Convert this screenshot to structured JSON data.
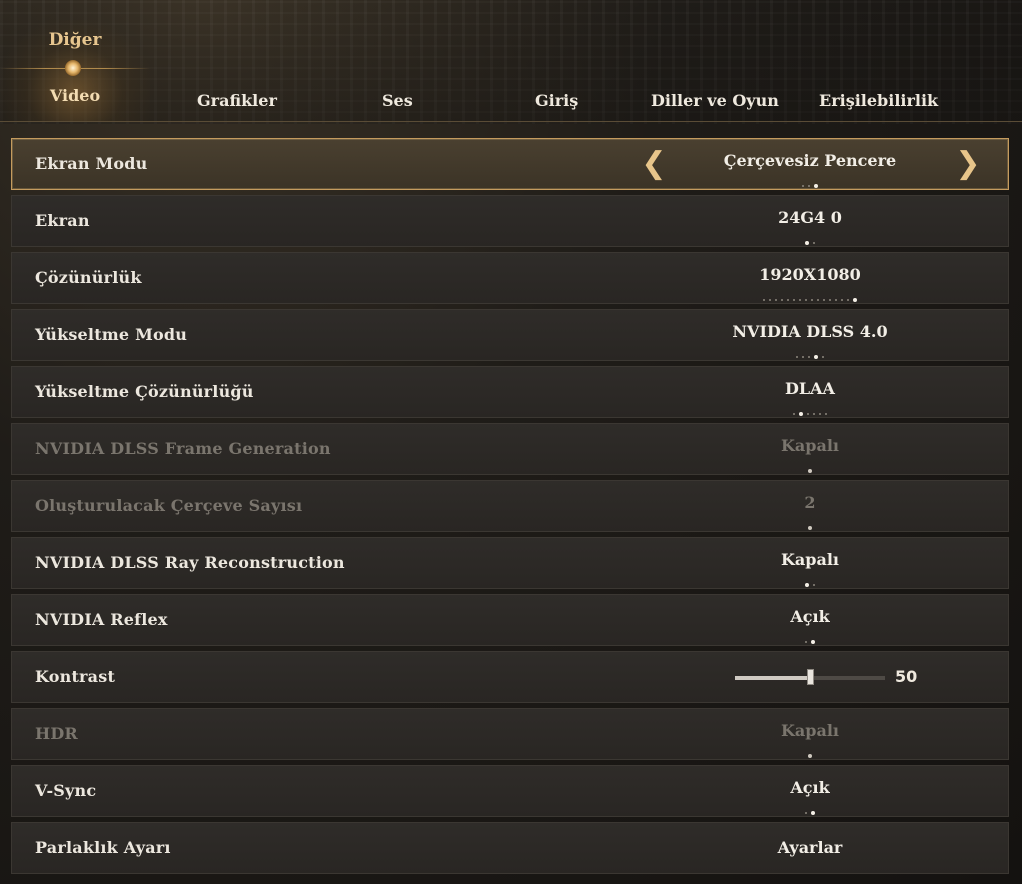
{
  "nav": {
    "active_group": "Diğer",
    "active_tab": "Video",
    "tabs": [
      {
        "label": "Grafikler"
      },
      {
        "label": "Ses"
      },
      {
        "label": "Giriş"
      },
      {
        "label": "Diller ve Oyun"
      },
      {
        "label": "Erişilebilirlik"
      }
    ]
  },
  "settings": [
    {
      "label": "Ekran Modu",
      "value": "Çerçevesiz Pencere",
      "selected": true,
      "disabled": false,
      "option_count": 3,
      "option_index": 2
    },
    {
      "label": "Ekran",
      "value": "24G4 0",
      "disabled": false,
      "option_count": 2,
      "option_index": 0
    },
    {
      "label": "Çözünürlük",
      "value": "1920X1080",
      "disabled": false,
      "option_count": 16,
      "option_index": 15
    },
    {
      "label": "Yükseltme Modu",
      "value": "NVIDIA DLSS 4.0",
      "disabled": false,
      "option_count": 5,
      "option_index": 3
    },
    {
      "label": "Yükseltme Çözünürlüğü",
      "value": "DLAA",
      "disabled": false,
      "option_count": 6,
      "option_index": 1
    },
    {
      "label": "NVIDIA DLSS Frame Generation",
      "value": "Kapalı",
      "disabled": true,
      "option_count": 1,
      "option_index": 0
    },
    {
      "label": "Oluşturulacak Çerçeve Sayısı",
      "value": "2",
      "disabled": true,
      "option_count": 1,
      "option_index": 0
    },
    {
      "label": "NVIDIA DLSS Ray Reconstruction",
      "value": "Kapalı",
      "disabled": false,
      "option_count": 2,
      "option_index": 0
    },
    {
      "label": "NVIDIA Reflex",
      "value": "Açık",
      "disabled": false,
      "option_count": 2,
      "option_index": 1
    },
    {
      "label": "Kontrast",
      "value": "50",
      "type": "slider",
      "slider_fraction": 0.5,
      "disabled": false
    },
    {
      "label": "HDR",
      "value": "Kapalı",
      "disabled": true,
      "option_count": 1,
      "option_index": 0
    },
    {
      "label": "V-Sync",
      "value": "Açık",
      "disabled": false,
      "option_count": 2,
      "option_index": 1
    },
    {
      "label": "Parlaklık Ayarı",
      "value": "Ayarlar",
      "type": "button",
      "disabled": false
    }
  ],
  "icons": {
    "prev": "chevron-left-icon",
    "next": "chevron-right-icon"
  },
  "colors": {
    "accent": "#c59b5e",
    "disabled_text": "#7a756d"
  }
}
